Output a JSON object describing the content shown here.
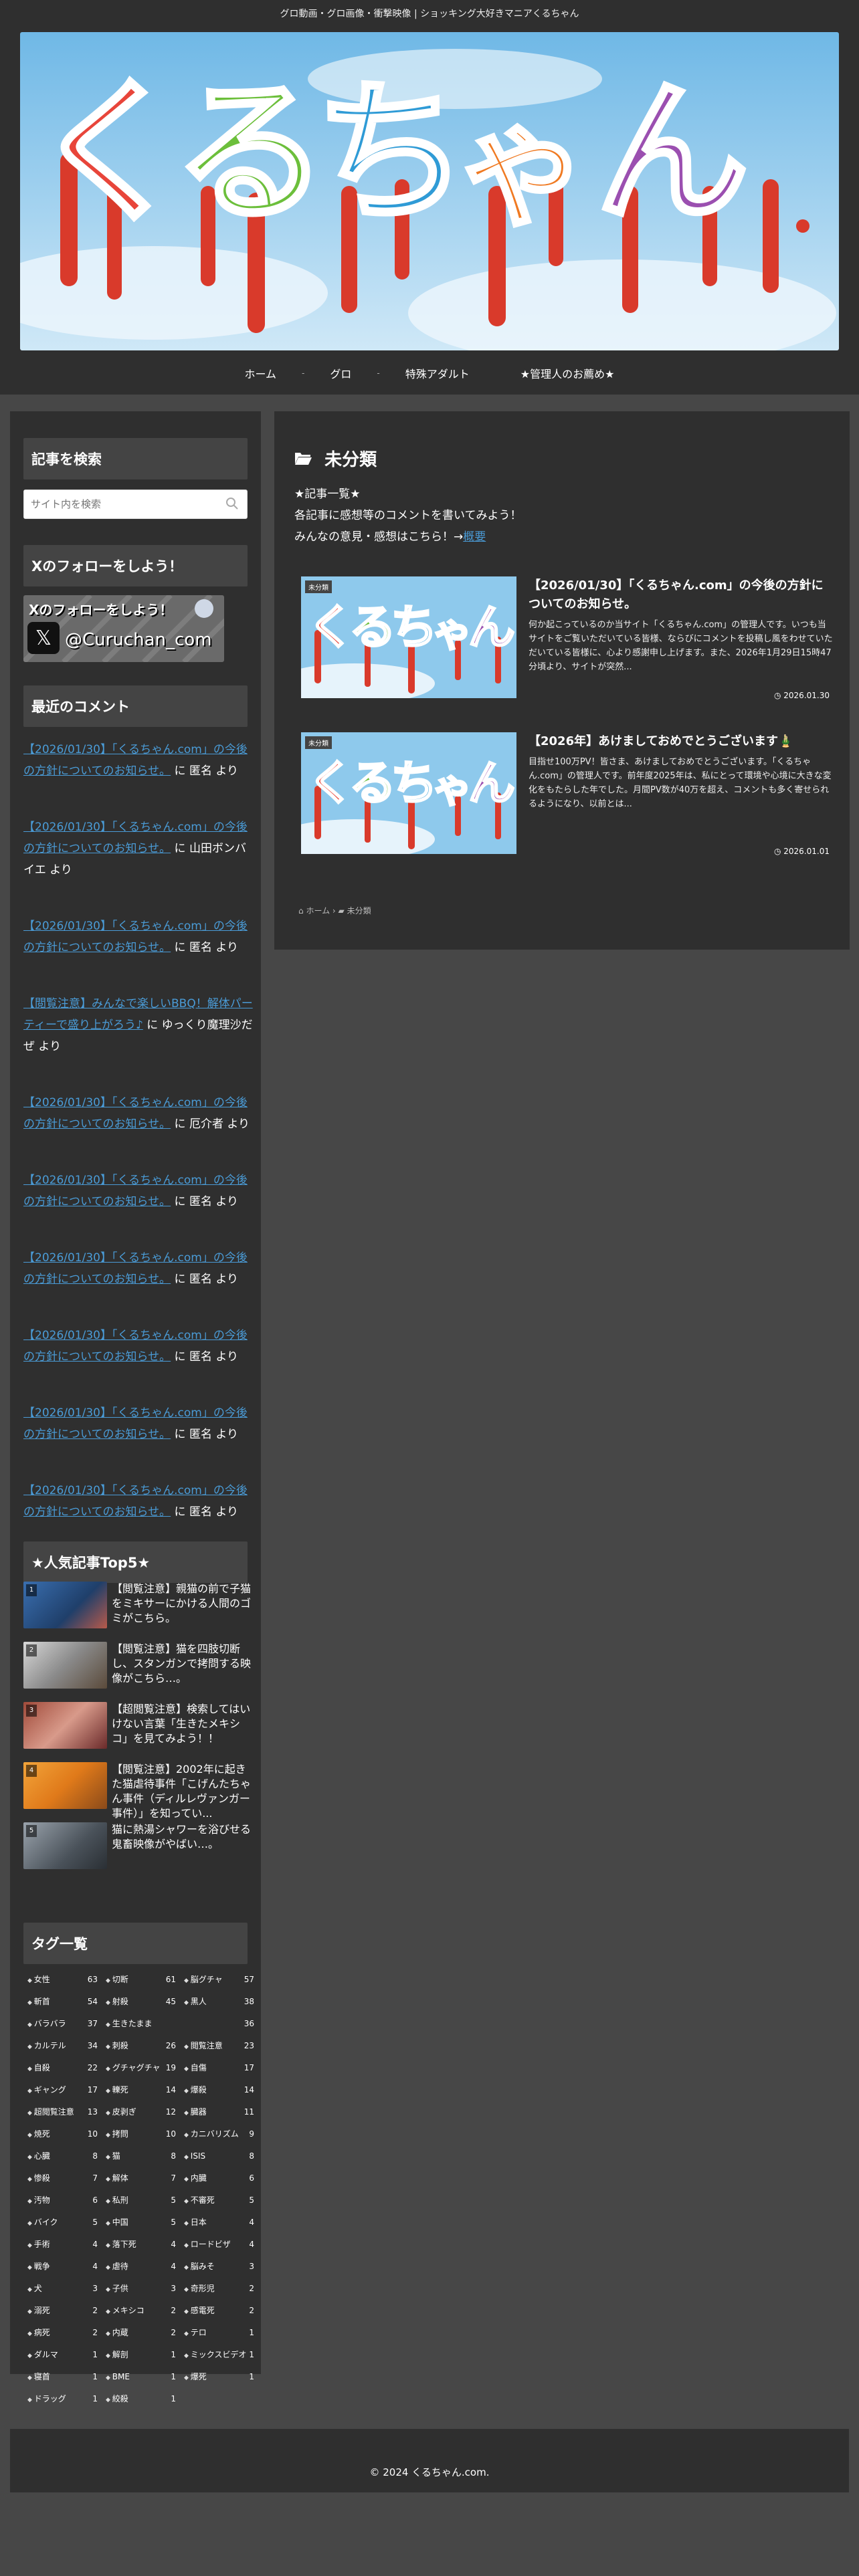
{
  "header": {
    "tagline": "グロ動画・グロ画像・衝撃映像 | ショッキング大好きマニアくるちゃん",
    "logo_text": "くるちゃん"
  },
  "nav": {
    "items": [
      "ホーム",
      "グロ",
      "特殊アダルト",
      "★管理人のお薦め★"
    ]
  },
  "sidebar": {
    "search": {
      "title": "記事を検索",
      "placeholder": "サイト内を検索"
    },
    "follow": {
      "title": "Xのフォローをしよう！",
      "banner_heading": "Xのフォローをしよう！",
      "banner_handle": "@Curuchan_com"
    },
    "comments": {
      "title": "最近のコメント",
      "items": [
        {
          "link": "【2026/01/30】「くるちゃん.com」の今後の方針についてのお知らせ。",
          "suffix": " に 匿名 より"
        },
        {
          "link": "【2026/01/30】「くるちゃん.com」の今後の方針についてのお知らせ。",
          "suffix": " に 山田ボンバイエ より"
        },
        {
          "link": "【2026/01/30】「くるちゃん.com」の今後の方針についてのお知らせ。",
          "suffix": " に 匿名 より"
        },
        {
          "link": "【閲覧注意】みんなで楽しいBBQ！解体パーティーで盛り上がろう♪",
          "suffix": " に ゆっくり魔理沙だぜ より"
        },
        {
          "link": "【2026/01/30】「くるちゃん.com」の今後の方針についてのお知らせ。",
          "suffix": " に 厄介者 より"
        },
        {
          "link": "【2026/01/30】「くるちゃん.com」の今後の方針についてのお知らせ。",
          "suffix": " に 匿名 より"
        },
        {
          "link": "【2026/01/30】「くるちゃん.com」の今後の方針についてのお知らせ。",
          "suffix": " に 匿名 より"
        },
        {
          "link": "【2026/01/30】「くるちゃん.com」の今後の方針についてのお知らせ。",
          "suffix": " に 匿名 より"
        },
        {
          "link": "【2026/01/30】「くるちゃん.com」の今後の方針についてのお知らせ。",
          "suffix": " に 匿名 より"
        },
        {
          "link": "【2026/01/30】「くるちゃん.com」の今後の方針についてのお知らせ。",
          "suffix": " に 匿名 より"
        }
      ]
    },
    "popular": {
      "title": "★人気記事Top5★",
      "items": [
        {
          "rank": "1",
          "title": "【閲覧注意】親猫の前で子猫をミキサーにかける人間のゴミがこちら。"
        },
        {
          "rank": "2",
          "title": "【閲覧注意】猫を四肢切断し、スタンガンで拷問する映像がこちら…。"
        },
        {
          "rank": "3",
          "title": "【超閲覧注意】検索してはいけない言葉「生きたメキシコ」を見てみよう！！"
        },
        {
          "rank": "4",
          "title": "【閲覧注意】2002年に起きた猫虐待事件「こげんたちゃん事件（ディルレヴァンガー事件）」を知ってい..."
        },
        {
          "rank": "5",
          "title": "猫に熱湯シャワーを浴びせる鬼畜映像がやばい…。"
        }
      ]
    },
    "tags": {
      "title": "タグ一覧",
      "items": [
        {
          "name": "女性",
          "count": "63"
        },
        {
          "name": "切断",
          "count": "61"
        },
        {
          "name": "脳グチャ",
          "count": "57"
        },
        {
          "name": "斬首",
          "count": "54"
        },
        {
          "name": "射殺",
          "count": "45"
        },
        {
          "name": "黒人",
          "count": "38"
        },
        {
          "name": "バラバラ",
          "count": "37"
        },
        {
          "name": "生きたまま",
          "count": "36"
        },
        {
          "name": "カルテル",
          "count": "34"
        },
        {
          "name": "刺殺",
          "count": "26"
        },
        {
          "name": "閲覧注意",
          "count": "23"
        },
        {
          "name": "自殺",
          "count": "22"
        },
        {
          "name": "グチャグチャ",
          "count": "19"
        },
        {
          "name": "自傷",
          "count": "17"
        },
        {
          "name": "ギャング",
          "count": "17"
        },
        {
          "name": "轢死",
          "count": "14"
        },
        {
          "name": "爆殺",
          "count": "14"
        },
        {
          "name": "超閲覧注意",
          "count": "13"
        },
        {
          "name": "皮剥ぎ",
          "count": "12"
        },
        {
          "name": "臓器",
          "count": "11"
        },
        {
          "name": "焼死",
          "count": "10"
        },
        {
          "name": "拷問",
          "count": "10"
        },
        {
          "name": "カニバリズム",
          "count": "9"
        },
        {
          "name": "心臓",
          "count": "8"
        },
        {
          "name": "猫",
          "count": "8"
        },
        {
          "name": "ISIS",
          "count": "8"
        },
        {
          "name": "惨殺",
          "count": "7"
        },
        {
          "name": "解体",
          "count": "7"
        },
        {
          "name": "内臓",
          "count": "6"
        },
        {
          "name": "汚物",
          "count": "6"
        },
        {
          "name": "私刑",
          "count": "5"
        },
        {
          "name": "不審死",
          "count": "5"
        },
        {
          "name": "バイク",
          "count": "5"
        },
        {
          "name": "中国",
          "count": "5"
        },
        {
          "name": "日本",
          "count": "4"
        },
        {
          "name": "手術",
          "count": "4"
        },
        {
          "name": "落下死",
          "count": "4"
        },
        {
          "name": "ロードビザ",
          "count": "4"
        },
        {
          "name": "戦争",
          "count": "4"
        },
        {
          "name": "虐待",
          "count": "4"
        },
        {
          "name": "脳みそ",
          "count": "3"
        },
        {
          "name": "犬",
          "count": "3"
        },
        {
          "name": "子供",
          "count": "3"
        },
        {
          "name": "奇形児",
          "count": "2"
        },
        {
          "name": "溺死",
          "count": "2"
        },
        {
          "name": "メキシコ",
          "count": "2"
        },
        {
          "name": "感電死",
          "count": "2"
        },
        {
          "name": "病死",
          "count": "2"
        },
        {
          "name": "内蔵",
          "count": "2"
        },
        {
          "name": "テロ",
          "count": "1"
        },
        {
          "name": "ダルマ",
          "count": "1"
        },
        {
          "name": "解剖",
          "count": "1"
        },
        {
          "name": "ミックスビデオ",
          "count": "1"
        },
        {
          "name": "寝首",
          "count": "1"
        },
        {
          "name": "BME",
          "count": "1"
        },
        {
          "name": "爆死",
          "count": "1"
        },
        {
          "name": "ドラッグ",
          "count": "1"
        },
        {
          "name": "絞殺",
          "count": "1"
        }
      ]
    }
  },
  "main": {
    "archive_title": "未分類",
    "desc_line1": "★記事一覧★",
    "desc_line2": "各記事に感想等のコメントを書いてみよう！",
    "desc_line3": "みんなの意見・感想はこちら！→",
    "desc_link": "概要",
    "cards": [
      {
        "category": "未分類",
        "title": "【2026/01/30】「くるちゃん.com」の今後の方針についてのお知らせ。",
        "snippet": "何か起こっているのか当サイト「くるちゃん.com」の管理人です。いつも当サイトをご覧いただいている皆様、ならびにコメントを投稿し風をわせていただいている皆様に、心より感謝申し上げます。また、2026年1月29日15時47分頃より、サイトが突然...",
        "date": "2026.01.30"
      },
      {
        "category": "未分類",
        "title": "【2026年】あけましておめでとうございます🎍",
        "snippet": "目指せ100万PV！皆さま、あけましておめでとうございます。「くるちゃん.com」の管理人です。前年度2025年は、私にとって環境や心境に大きな変化をもたらした年でした。月間PV数が40万を超え、コメントも多く寄せられるようになり、以前とは...",
        "date": "2026.01.01"
      }
    ],
    "breadcrumb": {
      "home": "ホーム",
      "current": "未分類"
    }
  },
  "footer": {
    "copyright": "© 2024 くるちゃん.com."
  }
}
